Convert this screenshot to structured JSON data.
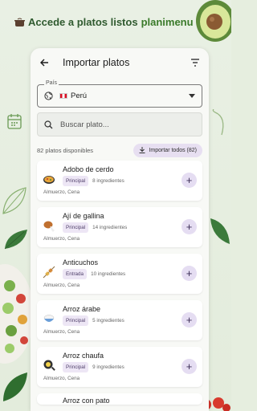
{
  "headline": {
    "prefix": "Accede a platos listos",
    "brand": "planimenu"
  },
  "appbar": {
    "title": "Importar platos"
  },
  "country": {
    "legend": "País",
    "value": "Perú"
  },
  "search": {
    "placeholder": "Buscar plato..."
  },
  "summary": {
    "count": "82 platos disponibles",
    "import_all": "Importar todos (82)"
  },
  "dishes": [
    {
      "name": "Adobo de cerdo",
      "category": "Principal",
      "ingredients": "8 ingredientes",
      "meals": "Almuerzo, Cena",
      "icon": "paella-icon"
    },
    {
      "name": "Ají de gallina",
      "category": "Principal",
      "ingredients": "14 ingredientes",
      "meals": "Almuerzo, Cena",
      "icon": "chicken-leg-icon"
    },
    {
      "name": "Anticuchos",
      "category": "Entrada",
      "ingredients": "10 ingredientes",
      "meals": "Almuerzo, Cena",
      "icon": "skewer-icon"
    },
    {
      "name": "Arroz árabe",
      "category": "Principal",
      "ingredients": "5 ingredientes",
      "meals": "Almuerzo, Cena",
      "icon": "rice-bowl-icon"
    },
    {
      "name": "Arroz chaufa",
      "category": "Principal",
      "ingredients": "9 ingredientes",
      "meals": "Almuerzo, Cena",
      "icon": "frying-pan-icon"
    },
    {
      "name": "Arroz con pato",
      "category": "",
      "ingredients": "",
      "meals": "",
      "icon": ""
    }
  ],
  "colors": {
    "accent": "#e5ddf2",
    "brand": "#3a7a2a",
    "background": "#e6eedf"
  }
}
